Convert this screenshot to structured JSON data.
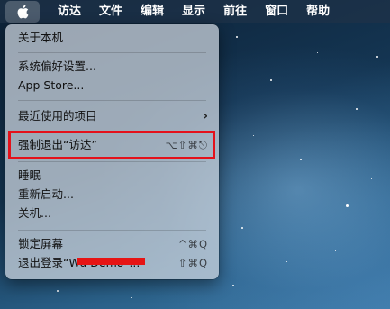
{
  "menubar": {
    "apple_icon": "apple-logo-icon",
    "items": [
      "访达",
      "文件",
      "编辑",
      "显示",
      "前往",
      "窗口",
      "帮助"
    ]
  },
  "apple_menu": {
    "about": "关于本机",
    "system_prefs": "系统偏好设置...",
    "app_store": "App Store...",
    "recent_items": "最近使用的项目",
    "force_quit": "强制退出“访达”",
    "force_quit_shortcut": "⌥⇧⌘⎋",
    "sleep": "睡眠",
    "restart": "重新启动...",
    "shutdown": "关机...",
    "lock_screen": "锁定屏幕",
    "lock_screen_shortcut": "^⌘Q",
    "logout": "退出登录“Wu Demo”...",
    "logout_shortcut": "⇧⌘Q"
  },
  "annotation": {
    "highlight_color": "#e4111b",
    "redaction_color": "#e61414"
  }
}
